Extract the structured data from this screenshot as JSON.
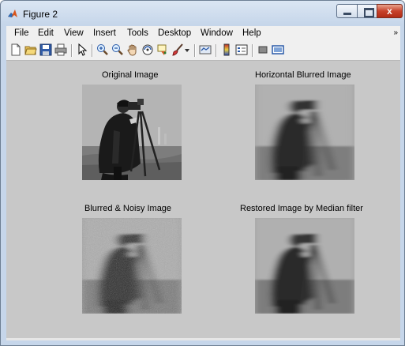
{
  "window": {
    "title": "Figure 2",
    "minimize_label": "",
    "maximize_label": "",
    "close_label": "x"
  },
  "menu": {
    "items": [
      "File",
      "Edit",
      "View",
      "Insert",
      "Tools",
      "Desktop",
      "Window",
      "Help"
    ],
    "overflow": "»"
  },
  "toolbar": {
    "icons": [
      "new-figure-icon",
      "open-file-icon",
      "save-figure-icon",
      "print-figure-icon",
      "edit-plot-icon",
      "zoom-in-icon",
      "zoom-out-icon",
      "pan-icon",
      "rotate-3d-icon",
      "data-cursor-icon",
      "brush-icon",
      "brush-dropdown-icon",
      "link-plot-icon",
      "insert-colorbar-icon",
      "insert-legend-icon",
      "hide-plot-tools-icon",
      "show-plot-tools-icon"
    ]
  },
  "subplots": [
    {
      "title": "Original Image",
      "variant": "original"
    },
    {
      "title": "Horizontal Blurred Image",
      "variant": "blurred"
    },
    {
      "title": "Blurred & Noisy Image",
      "variant": "noisy"
    },
    {
      "title": "Restored Image by Median filter",
      "variant": "restored"
    }
  ],
  "colors": {
    "figure_background": "#c8c8c8",
    "menu_background": "#f0f0f0",
    "title_bar": "#c6d6ea",
    "close_button": "#c7422b"
  }
}
